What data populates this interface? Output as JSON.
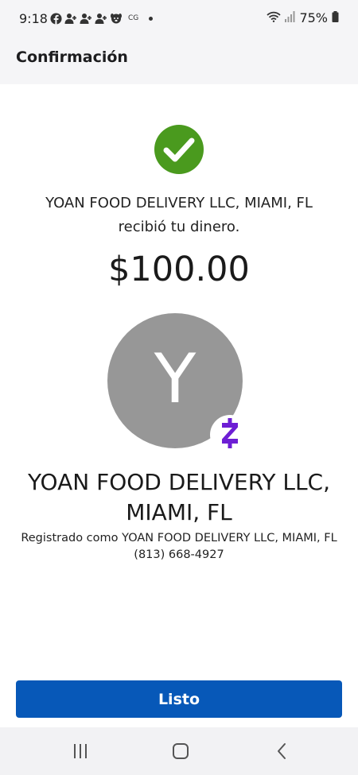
{
  "status_bar": {
    "time": "9:18",
    "carrier_text": "CG",
    "battery": "75%",
    "notification_icons": [
      "facebook-icon",
      "person-add-icon",
      "person-add-icon",
      "person-add-icon",
      "dog-icon"
    ]
  },
  "header": {
    "title": "Confirmación"
  },
  "confirmation": {
    "message_line1": "YOAN FOOD DELIVERY LLC, MIAMI, FL",
    "message_line2": "recibió tu dinero.",
    "amount": "$100.00",
    "success_color": "#4a9a1e"
  },
  "recipient": {
    "avatar_letter": "Y",
    "avatar_color": "#979797",
    "name_line1": "YOAN FOOD DELIVERY LLC,",
    "name_line2": "MIAMI, FL",
    "registered_as": "Registrado como YOAN FOOD DELIVERY LLC, MIAMI, FL",
    "phone": "(813) 668-4927",
    "badge_icon": "zelle-icon",
    "badge_color": "#6d1ed4"
  },
  "actions": {
    "done_label": "Listo",
    "done_color": "#0758b8"
  },
  "nav_bar": {
    "buttons": [
      "recent-apps-icon",
      "home-icon",
      "back-icon"
    ]
  }
}
